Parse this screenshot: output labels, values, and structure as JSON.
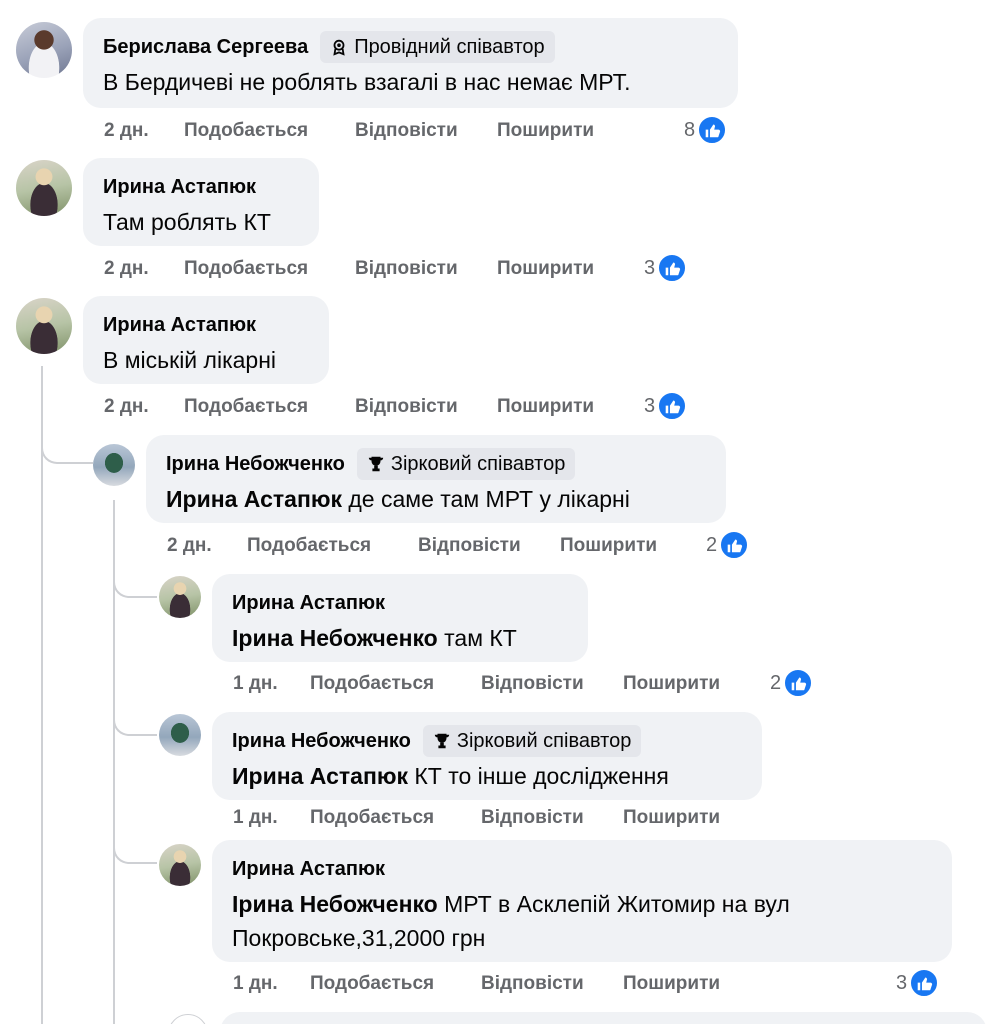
{
  "actions": {
    "like": "Подобається",
    "reply": "Відповісти",
    "share": "Поширити"
  },
  "colors": {
    "like_blue": "#1877f2",
    "bubble": "#f0f2f5",
    "meta_text": "#65676b"
  },
  "comments": [
    {
      "author": "Берислава Сергеева",
      "badge": "Провідний співавтор",
      "badge_icon": "top-contributor-icon",
      "text": "В Бердичеві не роблять взагалі в нас немає МРТ.",
      "time": "2 дн.",
      "reactions": "8"
    },
    {
      "author": "Ирина Астапюк",
      "text": "Там роблять КТ",
      "time": "2 дн.",
      "reactions": "3"
    },
    {
      "author": "Ирина Астапюк",
      "text": "В міській лікарні",
      "time": "2 дн.",
      "reactions": "3"
    },
    {
      "author": "Ірина Небожченко",
      "badge": "Зірковий співавтор",
      "badge_icon": "trophy-icon",
      "mention": "Ирина Астапюк",
      "text": " де саме там МРТ у лікарні",
      "time": "2 дн.",
      "reactions": "2"
    },
    {
      "author": "Ирина Астапюк",
      "mention": "Ірина Небожченко",
      "text": " там КТ",
      "time": "1 дн.",
      "reactions": "2"
    },
    {
      "author": "Ірина Небожченко",
      "badge": "Зірковий співавтор",
      "badge_icon": "trophy-icon",
      "mention": "Ирина Астапюк",
      "text": " КТ то інше дослідження",
      "time": "1 дн."
    },
    {
      "author": "Ирина Астапюк",
      "mention": "Ірина Небожченко",
      "text_line1": " МРТ в Асклепій Житомир на вул",
      "text_line2": "Покровське,31,2000 грн",
      "time": "1 дн.",
      "reactions": "3"
    }
  ]
}
